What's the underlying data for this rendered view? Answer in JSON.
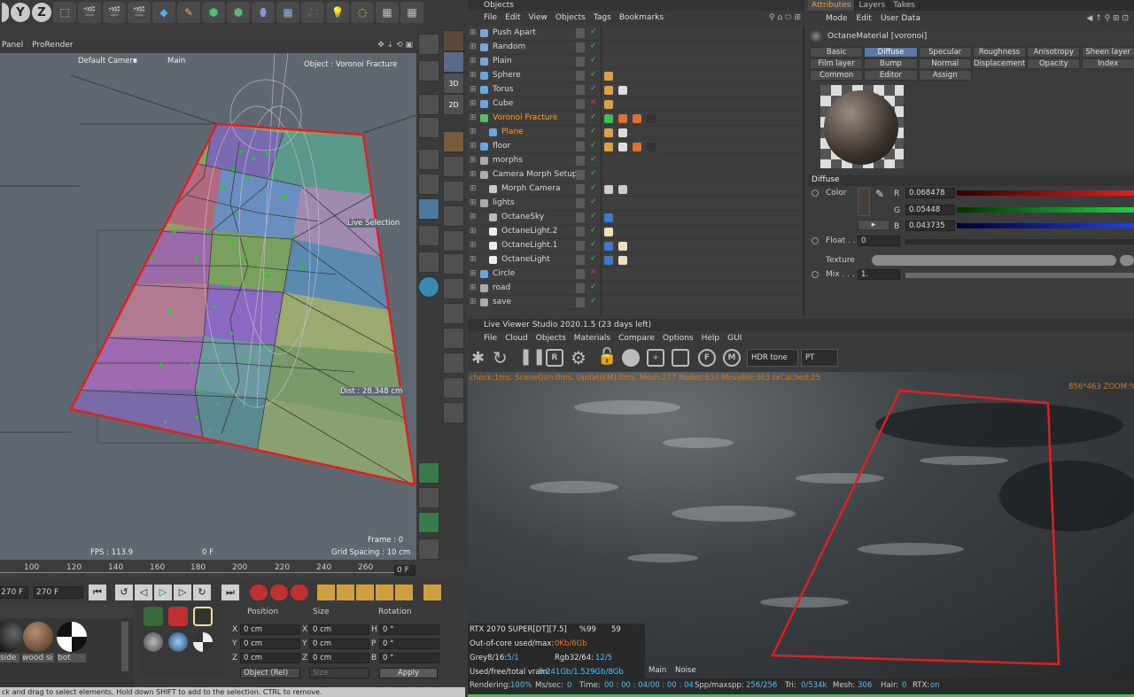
{
  "toolbar": {
    "axis_y": "Y",
    "axis_z": "Z"
  },
  "viewport": {
    "menu": [
      "Panel",
      "ProRender"
    ],
    "camera": "Default Camera",
    "camera_arrow": "▾",
    "main": "Main",
    "object_label": "Object : Voronoi Fracture",
    "live_selection": "Live Selection",
    "distance": "Dist : 28.348 cm",
    "fps": "FPS : 113.9",
    "frame_f": "0 F",
    "frame": "Frame : 0",
    "grid_spacing": "Grid Spacing : 10 cm"
  },
  "timeline": {
    "ticks": [
      "100",
      "120",
      "140",
      "160",
      "180",
      "200",
      "220",
      "240",
      "260"
    ],
    "current_frame": "0 F",
    "start_field": "270 F",
    "end_field": "270 F"
  },
  "materials": [
    {
      "name": "side"
    },
    {
      "name": "wood si"
    },
    {
      "name": "bot"
    }
  ],
  "coords": {
    "headers": [
      "Position",
      "Size",
      "Rotation"
    ],
    "rows": [
      {
        "axis": "X",
        "pos": "0 cm",
        "size_axis": "X",
        "size": "0 cm",
        "rot_axis": "H",
        "rot": "0 °"
      },
      {
        "axis": "Y",
        "pos": "0 cm",
        "size_axis": "Y",
        "size": "0 cm",
        "rot_axis": "P",
        "rot": "0 °"
      },
      {
        "axis": "Z",
        "pos": "0 cm",
        "size_axis": "Z",
        "size": "0 cm",
        "rot_axis": "B",
        "rot": "0 °"
      }
    ],
    "mode": "Object (Rel)",
    "size_mode": "Size",
    "apply": "Apply"
  },
  "status_bar": "ck and drag to select elements. Hold down SHIFT to add to the selection. CTRL to remove.",
  "objects": {
    "title": "Objects",
    "menu": [
      "File",
      "Edit",
      "View",
      "Objects",
      "Tags",
      "Bookmarks"
    ],
    "items": [
      {
        "name": "Push Apart",
        "indent": 0,
        "color": "#7da4d6",
        "highlight": false
      },
      {
        "name": "Random",
        "indent": 0,
        "color": "#7da4d6",
        "highlight": false
      },
      {
        "name": "Plain",
        "indent": 0,
        "color": "#7da4d6",
        "highlight": false
      },
      {
        "name": "Sphere",
        "indent": 0,
        "color": "#6aa6e0",
        "highlight": false
      },
      {
        "name": "Torus",
        "indent": 0,
        "color": "#6aa6e0",
        "highlight": false
      },
      {
        "name": "Cube",
        "indent": 0,
        "color": "#6aa6e0",
        "highlight": false
      },
      {
        "name": "Voronoi Fracture",
        "indent": 0,
        "color": "#55c060",
        "highlight": true
      },
      {
        "name": "Plane",
        "indent": 1,
        "color": "#6aa6e0",
        "highlight": true
      },
      {
        "name": "floor",
        "indent": 0,
        "color": "#6aa6e0",
        "highlight": false
      },
      {
        "name": "morphs",
        "indent": 0,
        "color": "#aaaaaa",
        "highlight": false
      },
      {
        "name": "Camera Morph Setup",
        "indent": 0,
        "color": "#aaaaaa",
        "highlight": false
      },
      {
        "name": "Morph Camera",
        "indent": 1,
        "color": "#cccccc",
        "highlight": false
      },
      {
        "name": "lights",
        "indent": 0,
        "color": "#aaaaaa",
        "highlight": false
      },
      {
        "name": "OctaneSky",
        "indent": 1,
        "color": "#bbbbbb",
        "highlight": false
      },
      {
        "name": "OctaneLight.2",
        "indent": 1,
        "color": "#eeeeee",
        "highlight": false
      },
      {
        "name": "OctaneLight.1",
        "indent": 1,
        "color": "#eeeeee",
        "highlight": false
      },
      {
        "name": "OctaneLight",
        "indent": 1,
        "color": "#eeeeee",
        "highlight": false
      },
      {
        "name": "Circle",
        "indent": 0,
        "color": "#6aa6e0",
        "highlight": false
      },
      {
        "name": "road",
        "indent": 0,
        "color": "#aaaaaa",
        "highlight": false
      },
      {
        "name": "save",
        "indent": 0,
        "color": "#aaaaaa",
        "highlight": false
      }
    ]
  },
  "attributes": {
    "tabs": [
      "Attributes",
      "Layers",
      "Takes"
    ],
    "menu": [
      "Mode",
      "Edit",
      "User Data"
    ],
    "material_name": "OctaneMaterial [voronoi]",
    "channel_tabs": [
      [
        "Basic",
        "Diffuse",
        "Specular",
        "Roughness",
        "Anisotropy",
        "Sheen layer"
      ],
      [
        "Film layer",
        "Bump",
        "Normal",
        "Displacement",
        "Opacity",
        "Index"
      ],
      [
        "Common",
        "Editor",
        "Assign"
      ]
    ],
    "selected_tab": "Diffuse",
    "section": "Diffuse",
    "color_label": "Color",
    "r_label": "R",
    "r": "0.068478",
    "g_label": "G",
    "g": "0.05448",
    "b_label": "B",
    "b": "0.043735",
    "float_label": "Float . .",
    "float_value": "0",
    "texture_label": "Texture",
    "mix_label": "Mix . . .",
    "mix_value": "1."
  },
  "live_viewer": {
    "title": "Live Viewer Studio 2020.1.5 (23 days left)",
    "menu": [
      "File",
      "Cloud",
      "Objects",
      "Materials",
      "Compare",
      "Options",
      "Help",
      "GUI"
    ],
    "tone_select": "HDR tone",
    "kernel_select": "PT",
    "overlay_top": "check:1ms. SceneGen:0ms. Update[M]:0ms. Mesh:277 Nodes:637 Movable:303 txCached:25",
    "overlay_right": "856*463 ZOOM:%",
    "gpu_label": "RTX 2070 SUPER[DT][7.5]",
    "gpu_pct": "%99",
    "gpu_temp": "59",
    "ooc_label": "Out-of-core used/max:",
    "ooc_value": "0Kb/6Gb",
    "grey_label": "Grey8/16:",
    "grey_value": "5/1",
    "rgb_label": "Rgb32/64:",
    "rgb_value": "12/5",
    "vram_label": "Used/free/total vram:",
    "vram_value": "5.241Gb/1.529Gb/8Gb",
    "tab_main": "Main",
    "tab_noise": "Noise",
    "rendering_label": "Rendering:",
    "rendering_value": "100%",
    "mssec_label": "Ms/sec:",
    "mssec_value": "0",
    "time_label": "Time:",
    "time_value": "00 : 00 : 04/00 : 00 : 04",
    "spp_label": "Spp/maxspp:",
    "spp_value": "256/256",
    "tri_label": "Tri:",
    "tri_value": "0/534k",
    "mesh_label": "Mesh:",
    "mesh_value": "306",
    "hair_label": "Hair:",
    "hair_value": "0",
    "rtx_label": "RTX:",
    "rtx_value": "on",
    "progress": 1.0
  }
}
